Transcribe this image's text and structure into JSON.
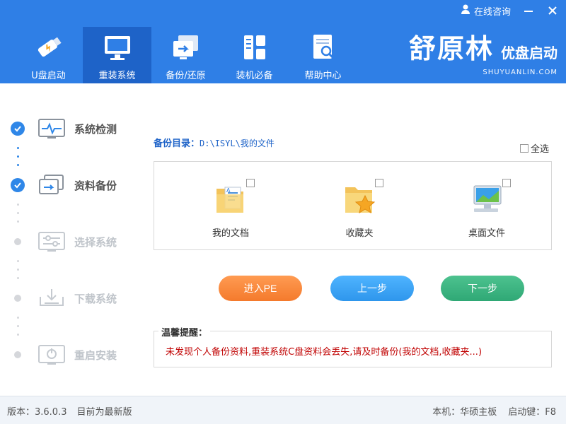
{
  "header": {
    "consult_label": "在线咨询",
    "nav": [
      {
        "label": "U盘启动",
        "icon": "usb-drive-icon",
        "active": false
      },
      {
        "label": "重装系统",
        "icon": "monitor-icon",
        "active": true
      },
      {
        "label": "备份/还原",
        "icon": "backup-restore-icon",
        "active": false
      },
      {
        "label": "装机必备",
        "icon": "software-grid-icon",
        "active": false
      },
      {
        "label": "帮助中心",
        "icon": "help-document-icon",
        "active": false
      }
    ],
    "brand": {
      "name": "舒原林",
      "sub": "优盘启动",
      "url": "SHUYUANLIN.COM"
    }
  },
  "sidebar": {
    "steps": [
      {
        "label": "系统检测",
        "status": "done",
        "icon": "waveform-icon"
      },
      {
        "label": "资料备份",
        "status": "done",
        "icon": "backup-icon"
      },
      {
        "label": "选择系统",
        "status": "todo",
        "icon": "settings-sliders-icon"
      },
      {
        "label": "下载系统",
        "status": "todo",
        "icon": "download-icon"
      },
      {
        "label": "重启安装",
        "status": "todo",
        "icon": "power-monitor-icon"
      }
    ]
  },
  "main": {
    "backup_dir_label": "备份目录：",
    "backup_dir_path": "D:\\ISYL\\我的文件",
    "select_all_label": "全选",
    "files": [
      {
        "label": "我的文档",
        "icon": "documents-folder-icon"
      },
      {
        "label": "收藏夹",
        "icon": "favorites-folder-icon"
      },
      {
        "label": "桌面文件",
        "icon": "desktop-computer-icon"
      }
    ],
    "buttons": {
      "pe": "进入PE",
      "prev": "上一步",
      "next": "下一步"
    },
    "tips": {
      "title": "温馨提醒：",
      "text": "未发现个人备份资料,重装系统C盘资料会丢失,请及时备份(我的文档,收藏夹...)"
    }
  },
  "status": {
    "version": "版本：3.6.0.3",
    "update": "目前为最新版",
    "board": "本机：华硕主板",
    "boot_key": "启动键：F8"
  },
  "colors": {
    "header": "#2f7fe6",
    "active_tab": "#1e63c8",
    "step_done": "#2f87e8",
    "warn": "#c00000"
  }
}
